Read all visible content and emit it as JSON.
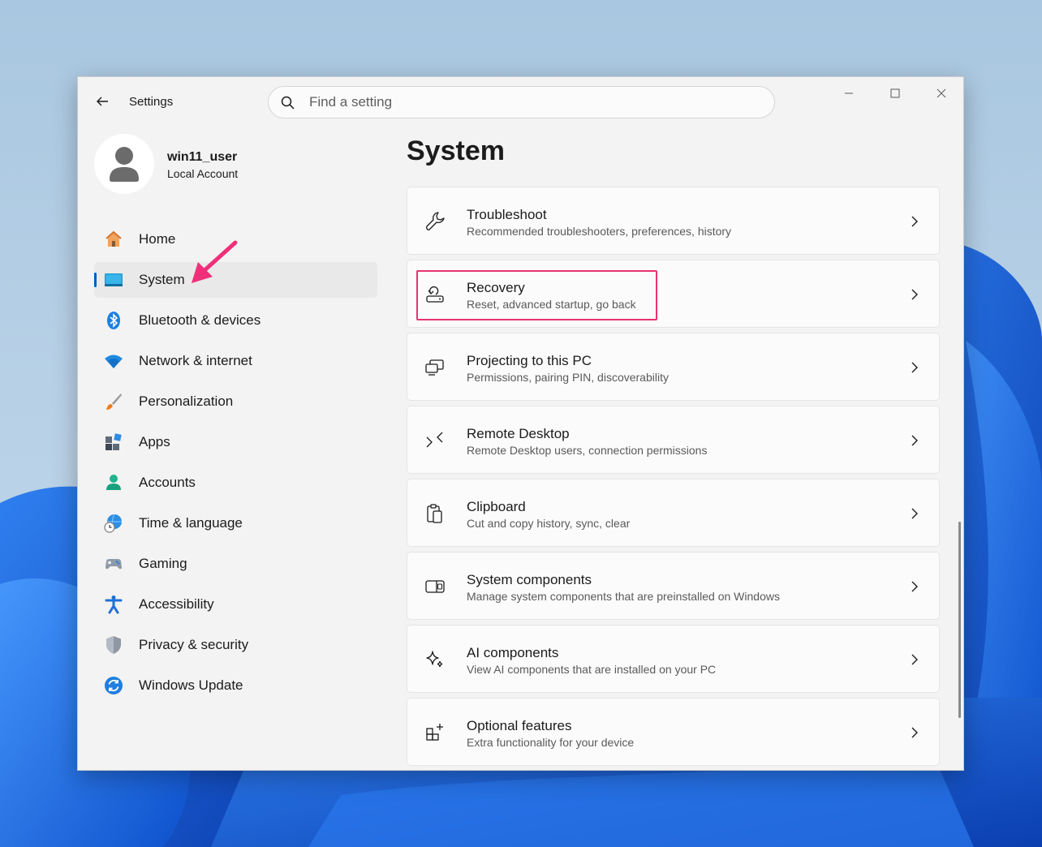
{
  "window": {
    "app_title": "Settings"
  },
  "search": {
    "placeholder": "Find a setting",
    "value": ""
  },
  "profile": {
    "name": "win11_user",
    "account_type": "Local Account"
  },
  "nav": {
    "items": [
      {
        "label": "Home",
        "icon": "home-icon"
      },
      {
        "label": "System",
        "icon": "system-icon",
        "selected": true
      },
      {
        "label": "Bluetooth & devices",
        "icon": "bluetooth-icon"
      },
      {
        "label": "Network & internet",
        "icon": "wifi-icon"
      },
      {
        "label": "Personalization",
        "icon": "brush-icon"
      },
      {
        "label": "Apps",
        "icon": "apps-icon"
      },
      {
        "label": "Accounts",
        "icon": "accounts-icon"
      },
      {
        "label": "Time & language",
        "icon": "globe-clock-icon"
      },
      {
        "label": "Gaming",
        "icon": "gamepad-icon"
      },
      {
        "label": "Accessibility",
        "icon": "accessibility-icon"
      },
      {
        "label": "Privacy & security",
        "icon": "shield-icon"
      },
      {
        "label": "Windows Update",
        "icon": "update-icon"
      }
    ]
  },
  "main": {
    "title": "System",
    "cards": [
      {
        "title": "Troubleshoot",
        "description": "Recommended troubleshooters, preferences, history",
        "icon": "wrench-icon"
      },
      {
        "title": "Recovery",
        "description": "Reset, advanced startup, go back",
        "icon": "recovery-icon",
        "highlighted": true
      },
      {
        "title": "Projecting to this PC",
        "description": "Permissions, pairing PIN, discoverability",
        "icon": "projecting-icon"
      },
      {
        "title": "Remote Desktop",
        "description": "Remote Desktop users, connection permissions",
        "icon": "remote-desktop-icon"
      },
      {
        "title": "Clipboard",
        "description": "Cut and copy history, sync, clear",
        "icon": "clipboard-icon"
      },
      {
        "title": "System components",
        "description": "Manage system components that are preinstalled on Windows",
        "icon": "system-components-icon"
      },
      {
        "title": "AI components",
        "description": "View AI components that are installed on your PC",
        "icon": "sparkle-icon"
      },
      {
        "title": "Optional features",
        "description": "Extra functionality for your device",
        "icon": "optional-features-icon"
      }
    ]
  },
  "colors": {
    "accent": "#005fb8",
    "highlight": "#e8336e",
    "window_bg": "#f3f3f3",
    "card_bg": "#fbfbfb"
  }
}
